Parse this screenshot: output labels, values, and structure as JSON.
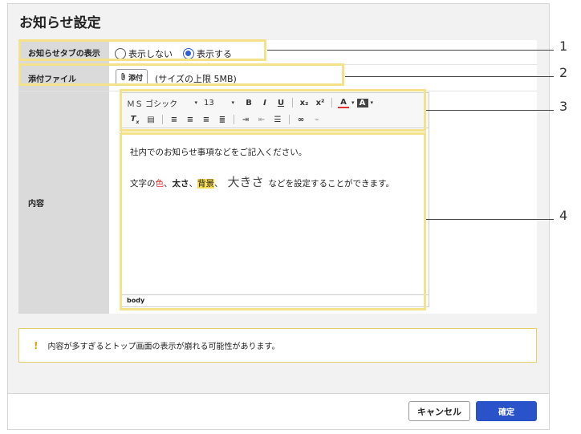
{
  "dialog": {
    "title": "お知らせ設定"
  },
  "rows": {
    "tab_display": {
      "label": "お知らせタブの表示",
      "options": [
        "表示しない",
        "表示する"
      ],
      "selected": "表示する"
    },
    "attachment": {
      "label": "添付ファイル",
      "button": "添付",
      "note": "(サイズの上限 5MB)"
    },
    "content": {
      "label": "内容",
      "toolbar": {
        "font": "ＭＳ ゴシック",
        "size": "13",
        "bold": "B",
        "italic": "I",
        "underline": "U",
        "subscript": "x₂",
        "superscript": "x²",
        "text_color": "A",
        "bg_color": "A"
      },
      "editor_text": {
        "line1": "社内でのお知らせ事項などをご記入ください。",
        "line2_a": "文字の",
        "line2_color": "色",
        "line2_sep1": "、",
        "line2_bold": "太さ",
        "line2_sep2": "、",
        "line2_bg": "背景",
        "line2_sep3": "、",
        "line2_big": "大きさ",
        "line2_b": "などを設定することができます。"
      },
      "statusbar": "body"
    }
  },
  "warning": {
    "icon": "!",
    "text": "内容が多すぎるとトップ画面の表示が崩れる可能性があります。"
  },
  "footer": {
    "cancel": "キャンセル",
    "ok": "確定"
  },
  "callouts": [
    "1",
    "2",
    "3",
    "4"
  ],
  "colors": {
    "primary": "#2b53c9",
    "highlight_frame": "#f3e28a",
    "warning_border": "#e7cf67",
    "label_bg": "#dadada"
  }
}
